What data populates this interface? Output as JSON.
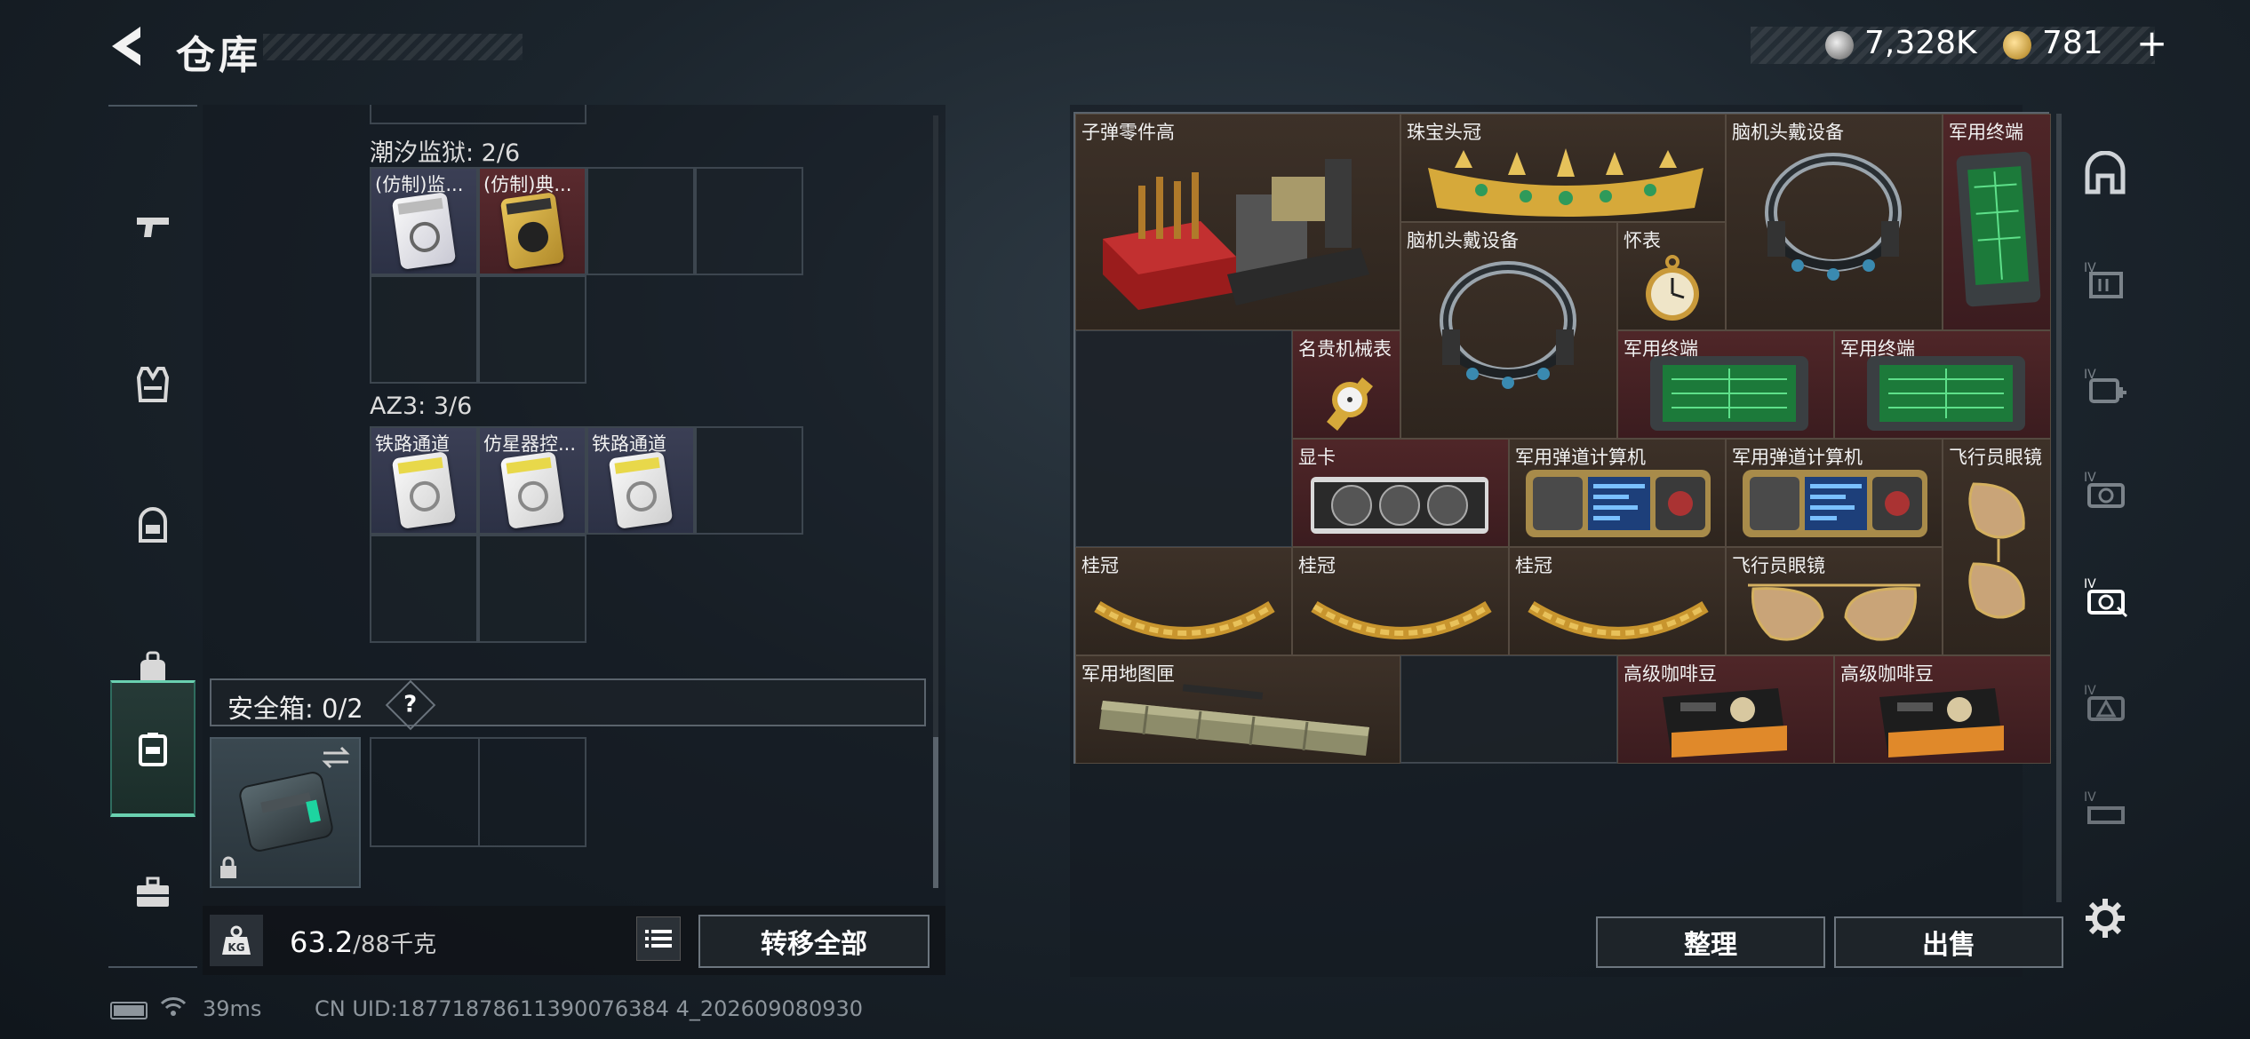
{
  "header": {
    "title": "仓库",
    "back_icon": "back-arrow-icon"
  },
  "currency": {
    "silver": "7,328K",
    "gold": "781",
    "plus": "+"
  },
  "left_nav": [
    {
      "icon": "pistol-icon"
    },
    {
      "icon": "armor-vest-icon"
    },
    {
      "icon": "helmet-icon"
    },
    {
      "icon": "backpack-icon"
    },
    {
      "icon": "safe-box-icon",
      "active": true
    },
    {
      "icon": "toolbox-icon"
    }
  ],
  "collections": [
    {
      "title": "潮汐监狱: 2/6",
      "items": [
        "(仿制)监...",
        "(仿制)典..."
      ]
    },
    {
      "title": "AZ3: 3/6",
      "items": [
        "铁路通道",
        "仿星器控...",
        "铁路通道"
      ]
    }
  ],
  "safe": {
    "label": "安全箱: 0/2",
    "help": "?"
  },
  "weight": {
    "current": "63.2",
    "max": "/88千克",
    "icon": "KG"
  },
  "buttons": {
    "transfer_all": "转移全部",
    "sort": "整理",
    "sell": "出售"
  },
  "footer": {
    "ping": "39ms",
    "uid": "CN UID:18771878611390076384 4_202609080930"
  },
  "stash_items": [
    {
      "label": "子弹零件高"
    },
    {
      "label": "珠宝头冠"
    },
    {
      "label": "脑机头戴设备"
    },
    {
      "label": "军用终端"
    },
    {
      "label": "脑机头戴设备"
    },
    {
      "label": "怀表"
    },
    {
      "label": "名贵机械表"
    },
    {
      "label": "军用终端"
    },
    {
      "label": "军用终端"
    },
    {
      "label": "显卡"
    },
    {
      "label": "军用弹道计算机"
    },
    {
      "label": "军用弹道计算机"
    },
    {
      "label": "飞行员眼镜"
    },
    {
      "label": "桂冠"
    },
    {
      "label": "桂冠"
    },
    {
      "label": "桂冠"
    },
    {
      "label": "飞行员眼镜"
    },
    {
      "label": "军用地图匣"
    },
    {
      "label": "高级咖啡豆"
    },
    {
      "label": "高级咖啡豆"
    }
  ],
  "right_nav": [
    {
      "icon": "home-arch-icon"
    },
    {
      "icon": "tier-iv-crate-icon",
      "tier": "IV"
    },
    {
      "icon": "tier-iv-medkit-icon",
      "tier": "IV"
    },
    {
      "icon": "tier-iv-camera-icon",
      "tier": "IV"
    },
    {
      "icon": "tier-iv-valuables-icon",
      "tier": "IV"
    },
    {
      "icon": "tier-iv-triangle-icon",
      "tier": "IV"
    },
    {
      "icon": "tier-iv-ammo-icon",
      "tier": "IV"
    },
    {
      "icon": "settings-gear-icon"
    }
  ]
}
